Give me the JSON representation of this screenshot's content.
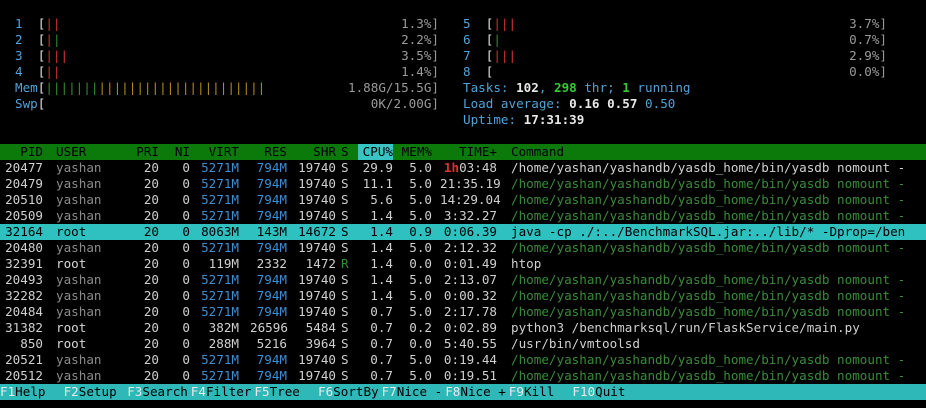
{
  "cpus_left": [
    {
      "id": "1",
      "bar_red": "||",
      "bar_green": "",
      "pct": "1.3%]"
    },
    {
      "id": "2",
      "bar_red": "|",
      "bar_green": "|",
      "pct": "2.2%]"
    },
    {
      "id": "3",
      "bar_red": "|||",
      "bar_green": "",
      "pct": "3.5%]"
    },
    {
      "id": "4",
      "bar_red": "||",
      "bar_green": "",
      "pct": "1.4%]"
    }
  ],
  "cpus_right": [
    {
      "id": "5",
      "bar_red": "|||",
      "bar_green": "",
      "pct": "3.7%]"
    },
    {
      "id": "6",
      "bar_red": "",
      "bar_green": "|",
      "pct": "0.7%]"
    },
    {
      "id": "7",
      "bar_red": "|||",
      "bar_green": "",
      "pct": "2.9%]"
    },
    {
      "id": "8",
      "bar_red": "",
      "bar_green": "",
      "pct": "0.0%]"
    }
  ],
  "mem": {
    "label": "Mem",
    "bar_green": "|||||||",
    "bar_yellow": "||||||||||||||||||||||",
    "value": "1.88G/15.5G]"
  },
  "swp": {
    "label": "Swp",
    "value": "0K/2.00G]"
  },
  "tasks": {
    "label": "Tasks: ",
    "count": "102",
    "sep1": ", ",
    "thr": "298",
    "thr_label": " thr; ",
    "running": "1",
    "running_label": " running"
  },
  "load": {
    "label": "Load average: ",
    "v1": "0.16",
    "v2": "0.57",
    "v3": "0.50"
  },
  "uptime": {
    "label": "Uptime: ",
    "value": "17:31:39"
  },
  "columns": [
    "PID",
    "USER",
    "PRI",
    "NI",
    "VIRT",
    "RES",
    "SHR",
    "S",
    "CPU%",
    "MEM%",
    "TIME+",
    "Command"
  ],
  "processes": [
    {
      "pid": "20477",
      "user": "yashan",
      "pri": "20",
      "ni": "0",
      "virt": "5271M",
      "res": "794M",
      "shr": "19740",
      "s": "S",
      "cpu": "29.9",
      "mem": "5.0",
      "time_h": "1h",
      "time": "03:48",
      "cmd": "/home/yashan/yashandb/yasdb_home/bin/yasdb nomount -",
      "cmd_style": "white"
    },
    {
      "pid": "20479",
      "user": "yashan",
      "pri": "20",
      "ni": "0",
      "virt": "5271M",
      "res": "794M",
      "shr": "19740",
      "s": "S",
      "cpu": "11.1",
      "mem": "5.0",
      "time_h": "",
      "time": "21:35.19",
      "cmd": "/home/yashan/yashandb/yasdb_home/bin/yasdb nomount -",
      "cmd_style": "green"
    },
    {
      "pid": "20510",
      "user": "yashan",
      "pri": "20",
      "ni": "0",
      "virt": "5271M",
      "res": "794M",
      "shr": "19740",
      "s": "S",
      "cpu": "5.6",
      "mem": "5.0",
      "time_h": "",
      "time": "14:29.04",
      "cmd": "/home/yashan/yashandb/yasdb_home/bin/yasdb nomount -",
      "cmd_style": "green"
    },
    {
      "pid": "20509",
      "user": "yashan",
      "pri": "20",
      "ni": "0",
      "virt": "5271M",
      "res": "794M",
      "shr": "19740",
      "s": "S",
      "cpu": "1.4",
      "mem": "5.0",
      "time_h": "",
      "time": "3:32.27",
      "cmd": "/home/yashan/yashandb/yasdb_home/bin/yasdb nomount -",
      "cmd_style": "green"
    },
    {
      "pid": "32164",
      "user": "root",
      "pri": "20",
      "ni": "0",
      "virt": "8063M",
      "res": "143M",
      "shr": "14672",
      "s": "S",
      "cpu": "1.4",
      "mem": "0.9",
      "time_h": "",
      "time": "0:06.39",
      "cmd": "java -cp ./:../BenchmarkSQL.jar:../lib/* -Dprop=/ben",
      "cmd_style": "white"
    },
    {
      "pid": "20480",
      "user": "yashan",
      "pri": "20",
      "ni": "0",
      "virt": "5271M",
      "res": "794M",
      "shr": "19740",
      "s": "S",
      "cpu": "1.4",
      "mem": "5.0",
      "time_h": "",
      "time": "2:12.32",
      "cmd": "/home/yashan/yashandb/yasdb_home/bin/yasdb nomount -",
      "cmd_style": "green"
    },
    {
      "pid": "32391",
      "user": "root",
      "pri": "20",
      "ni": "0",
      "virt": "119M",
      "res": "2332",
      "shr": "1472",
      "s": "R",
      "cpu": "1.4",
      "mem": "0.0",
      "time_h": "",
      "time": "0:01.49",
      "cmd": "htop",
      "cmd_style": "white"
    },
    {
      "pid": "20493",
      "user": "yashan",
      "pri": "20",
      "ni": "0",
      "virt": "5271M",
      "res": "794M",
      "shr": "19740",
      "s": "S",
      "cpu": "1.4",
      "mem": "5.0",
      "time_h": "",
      "time": "2:13.07",
      "cmd": "/home/yashan/yashandb/yasdb_home/bin/yasdb nomount -",
      "cmd_style": "green"
    },
    {
      "pid": "32282",
      "user": "yashan",
      "pri": "20",
      "ni": "0",
      "virt": "5271M",
      "res": "794M",
      "shr": "19740",
      "s": "S",
      "cpu": "1.4",
      "mem": "5.0",
      "time_h": "",
      "time": "0:00.32",
      "cmd": "/home/yashan/yashandb/yasdb_home/bin/yasdb nomount -",
      "cmd_style": "green"
    },
    {
      "pid": "20484",
      "user": "yashan",
      "pri": "20",
      "ni": "0",
      "virt": "5271M",
      "res": "794M",
      "shr": "19740",
      "s": "S",
      "cpu": "0.7",
      "mem": "5.0",
      "time_h": "",
      "time": "2:17.78",
      "cmd": "/home/yashan/yashandb/yasdb_home/bin/yasdb nomount -",
      "cmd_style": "green"
    },
    {
      "pid": "31382",
      "user": "root",
      "pri": "20",
      "ni": "0",
      "virt": "382M",
      "res": "26596",
      "shr": "5484",
      "s": "S",
      "cpu": "0.7",
      "mem": "0.2",
      "time_h": "",
      "time": "0:02.89",
      "cmd": "python3 /benchmarksql/run/FlaskService/main.py",
      "cmd_style": "white"
    },
    {
      "pid": "850",
      "user": "root",
      "pri": "20",
      "ni": "0",
      "virt": "288M",
      "res": "5216",
      "shr": "3964",
      "s": "S",
      "cpu": "0.7",
      "mem": "0.0",
      "time_h": "",
      "time": "5:40.55",
      "cmd": "/usr/bin/vmtoolsd",
      "cmd_style": "white"
    },
    {
      "pid": "20521",
      "user": "yashan",
      "pri": "20",
      "ni": "0",
      "virt": "5271M",
      "res": "794M",
      "shr": "19740",
      "s": "S",
      "cpu": "0.7",
      "mem": "5.0",
      "time_h": "",
      "time": "0:19.44",
      "cmd": "/home/yashan/yashandb/yasdb_home/bin/yasdb nomount -",
      "cmd_style": "green"
    },
    {
      "pid": "20512",
      "user": "yashan",
      "pri": "20",
      "ni": "0",
      "virt": "5271M",
      "res": "794M",
      "shr": "19740",
      "s": "S",
      "cpu": "0.7",
      "mem": "5.0",
      "time_h": "",
      "time": "0:19.51",
      "cmd": "/home/yashan/yashandb/yasdb_home/bin/yasdb nomount -",
      "cmd_style": "green"
    }
  ],
  "function_keys": [
    {
      "key": "F1",
      "label": "Help  "
    },
    {
      "key": "F2",
      "label": "Setup "
    },
    {
      "key": "F3",
      "label": "Search"
    },
    {
      "key": "F4",
      "label": "Filter"
    },
    {
      "key": "F5",
      "label": "Tree  "
    },
    {
      "key": "F6",
      "label": "SortBy"
    },
    {
      "key": "F7",
      "label": "Nice -"
    },
    {
      "key": "F8",
      "label": "Nice +"
    },
    {
      "key": "F9",
      "label": "Kill  "
    },
    {
      "key": "F10",
      "label": "Quit"
    }
  ],
  "colors": {
    "header_bg": "#0b7a0b",
    "selected_bg": "#2fc0c0",
    "accent": "#4fa3d8"
  }
}
